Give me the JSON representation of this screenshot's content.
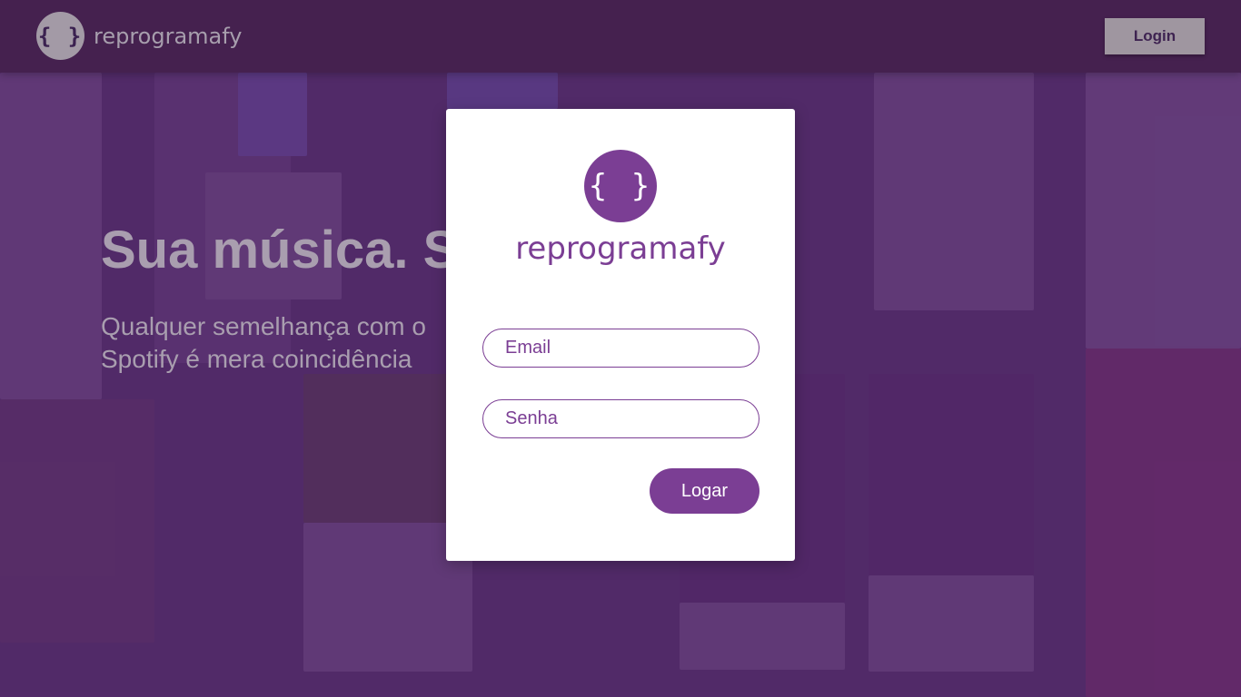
{
  "header": {
    "logo_glyph": "{ }",
    "brand_name": "reprogramafy",
    "login_label": "Login"
  },
  "hero": {
    "title": "Sua música. Sua emoção.",
    "subtitle": "Qualquer semelhança com o Spotify é mera coincidência"
  },
  "modal": {
    "logo_glyph": "{ }",
    "brand_name": "reprogramafy",
    "email_placeholder": "Email",
    "password_placeholder": "Senha",
    "submit_label": "Logar"
  },
  "colors": {
    "brand_purple": "#7b3e94",
    "header_bg": "#45214f",
    "background_overlay": "#582a6e",
    "muted_text": "#a99eaf"
  }
}
